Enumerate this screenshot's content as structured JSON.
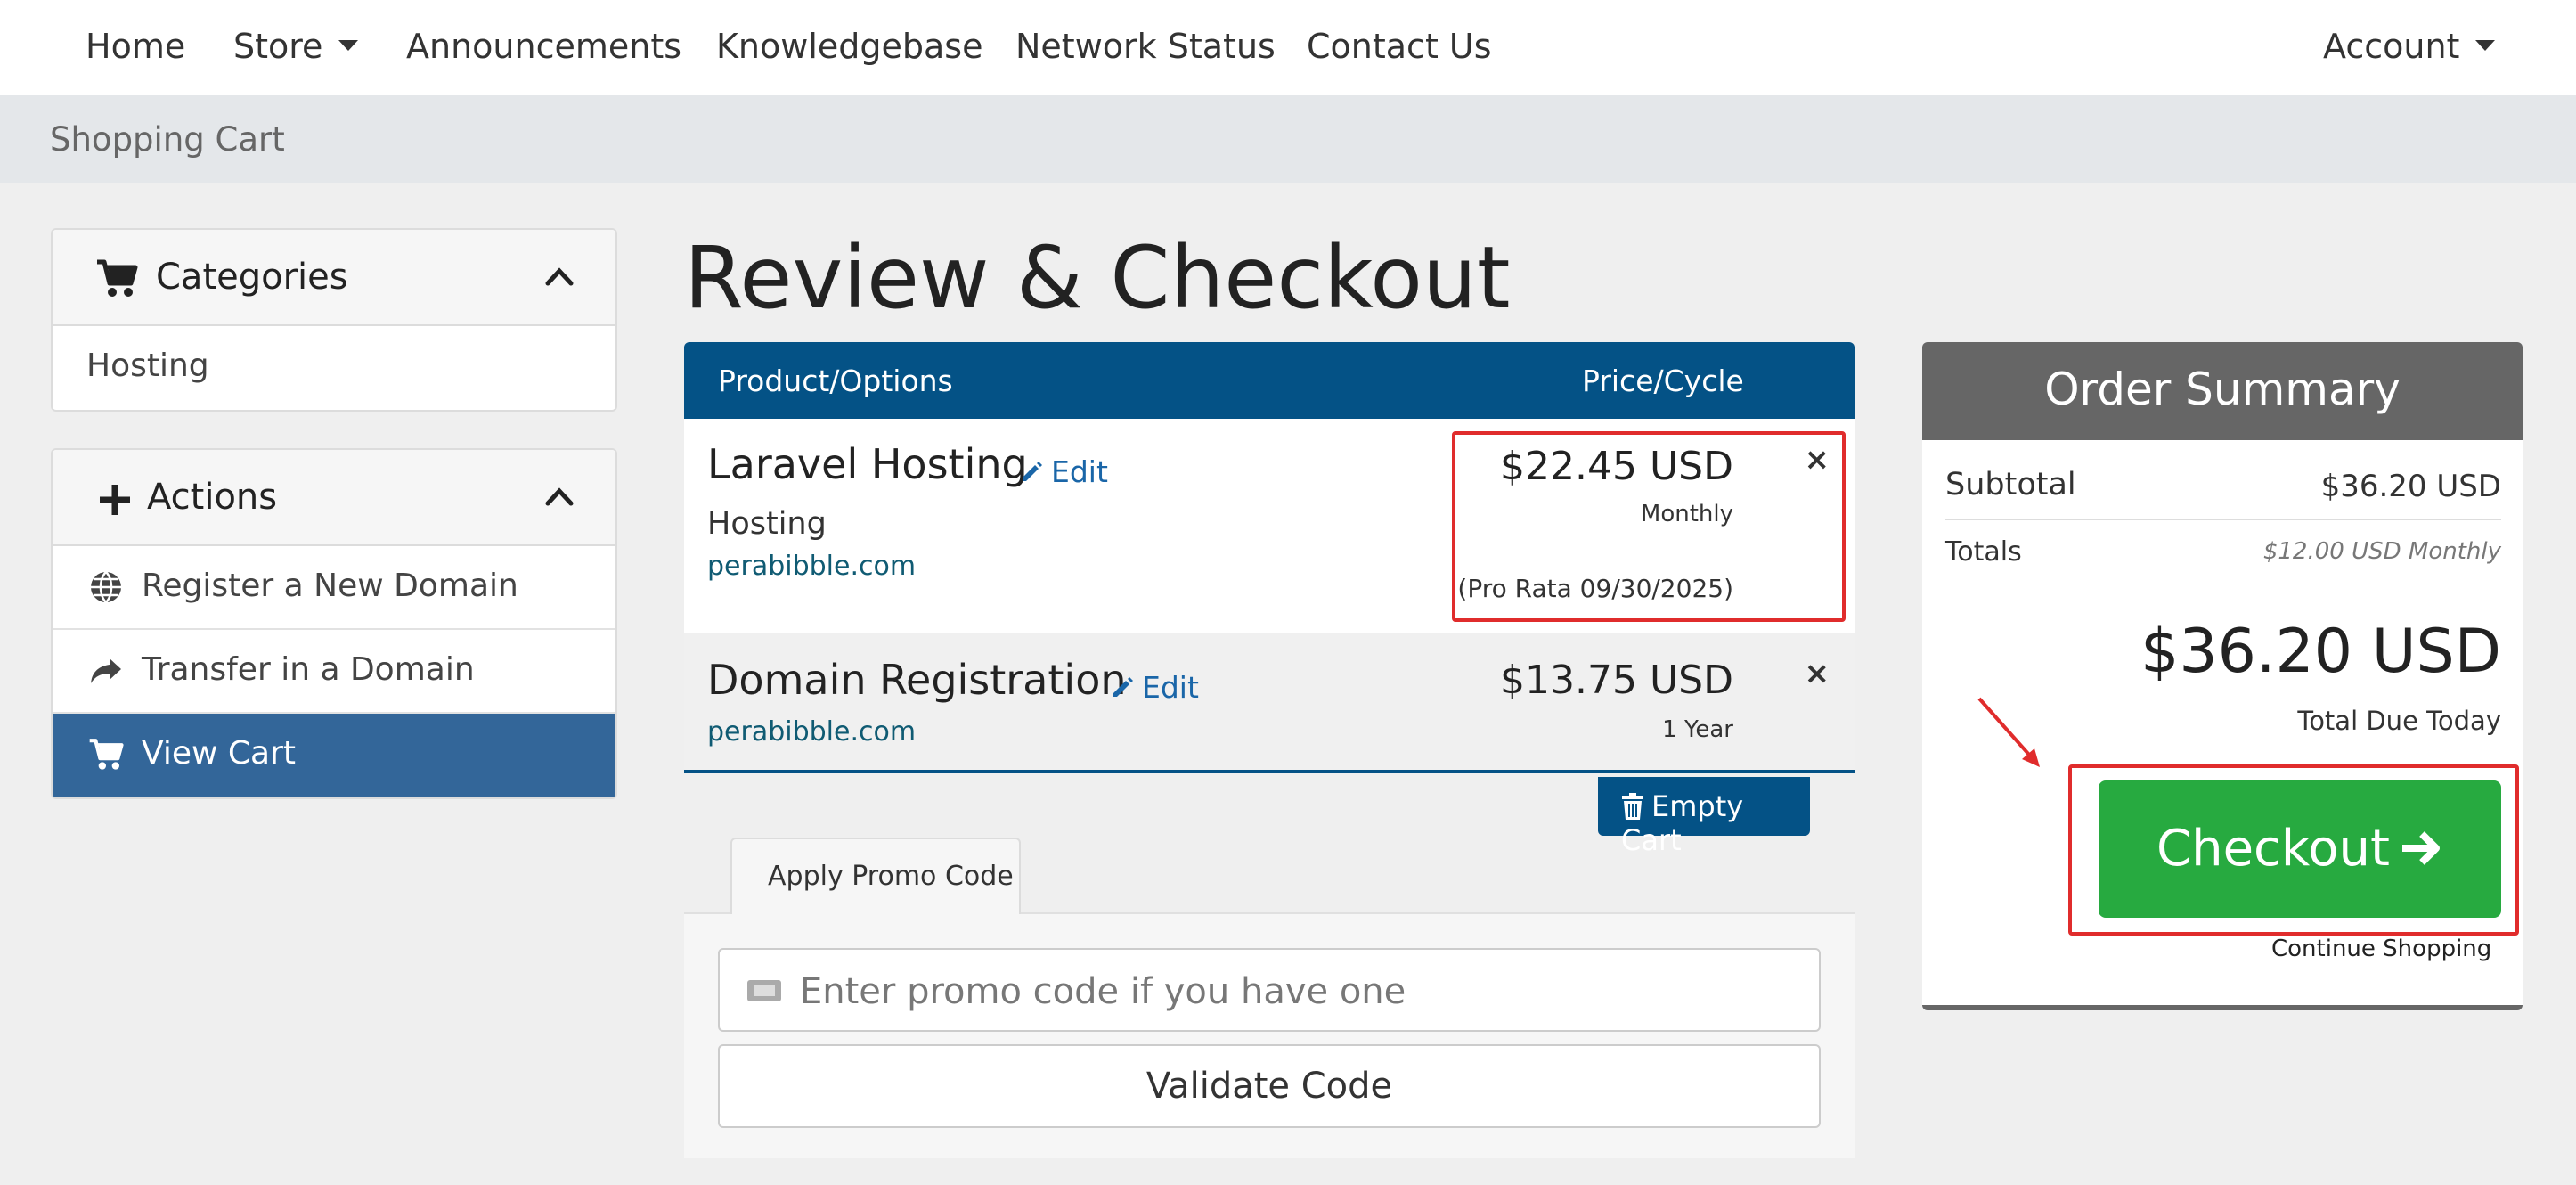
{
  "nav": {
    "home": "Home",
    "store": "Store",
    "announcements": "Announcements",
    "knowledgebase": "Knowledgebase",
    "network_status": "Network Status",
    "contact_us": "Contact Us",
    "account": "Account"
  },
  "breadcrumb": "Shopping Cart",
  "sidebar": {
    "categories_title": "Categories",
    "categories": [
      {
        "label": "Hosting"
      }
    ],
    "actions_title": "Actions",
    "actions": [
      {
        "label": "Register a New Domain",
        "icon": "globe-icon"
      },
      {
        "label": "Transfer in a Domain",
        "icon": "share-icon"
      },
      {
        "label": "View Cart",
        "icon": "cart-icon",
        "active": true
      }
    ]
  },
  "main": {
    "title": "Review & Checkout",
    "table_headers": {
      "product": "Product/Options",
      "price": "Price/Cycle"
    },
    "items": [
      {
        "name": "Laravel Hosting",
        "edit": "Edit",
        "group": "Hosting",
        "domain": "perabibble.com",
        "price": "$22.45 USD",
        "cycle": "Monthly",
        "pro_rata": "(Pro Rata 09/30/2025)",
        "remove": "×"
      },
      {
        "name": "Domain Registration",
        "edit": "Edit",
        "domain": "perabibble.com",
        "price": "$13.75 USD",
        "cycle": "1 Year",
        "remove": "×"
      }
    ],
    "empty_cart": "Empty Cart",
    "promo": {
      "tab": "Apply Promo Code",
      "placeholder": "Enter promo code if you have one",
      "validate": "Validate Code"
    }
  },
  "summary": {
    "title": "Order Summary",
    "subtotal_label": "Subtotal",
    "subtotal": "$36.20 USD",
    "totals_label": "Totals",
    "totals_value": "$12.00 USD Monthly",
    "total_due": "$36.20 USD",
    "total_due_label": "Total Due Today",
    "checkout": "Checkout",
    "continue": "Continue Shopping"
  },
  "colors": {
    "primary": "#045286",
    "checkout_green": "#27aa40",
    "summary_header": "#666666",
    "annotation_red": "#e02c2c",
    "active_sidebar": "#336699"
  }
}
